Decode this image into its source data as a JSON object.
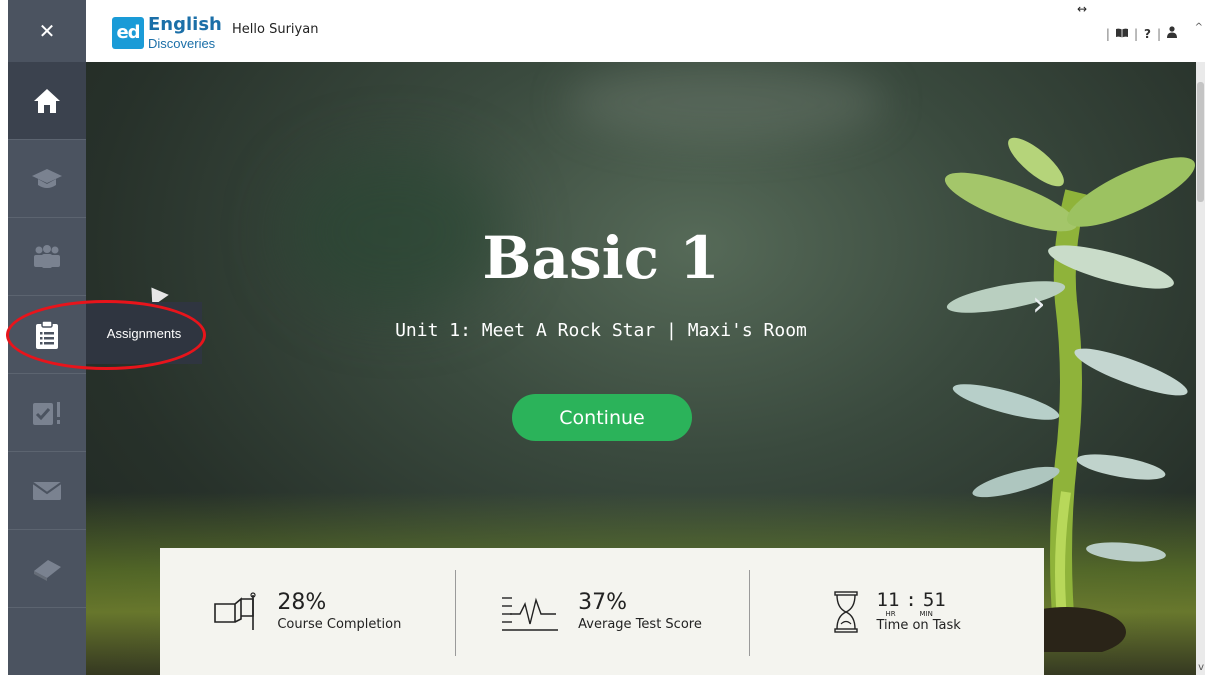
{
  "topbar": {
    "close_glyph": "✕",
    "logo_badge": "ed",
    "logo_word": "English",
    "logo_sub": "Discoveries",
    "greeting": "Hello Suriyan",
    "help_glyph": "?"
  },
  "sidebar": {
    "items": [
      {
        "id": "home",
        "icon": "home-icon"
      },
      {
        "id": "courses",
        "icon": "graduation-cap-icon"
      },
      {
        "id": "community",
        "icon": "users-icon"
      },
      {
        "id": "assignments",
        "icon": "clipboard-list-icon",
        "tooltip": "Assignments"
      },
      {
        "id": "tests",
        "icon": "checklist-alert-icon"
      },
      {
        "id": "messages",
        "icon": "envelope-icon"
      },
      {
        "id": "dictionary",
        "icon": "book-icon"
      }
    ]
  },
  "hero": {
    "title": "Basic 1",
    "subtitle": "Unit 1: Meet A Rock Star | Maxi's Room",
    "continue_label": "Continue",
    "next_glyph": "›"
  },
  "stats": {
    "completion": {
      "value": "28%",
      "label": "Course Completion",
      "icon": "flag-icon"
    },
    "test_score": {
      "value": "37%",
      "label": "Average Test Score",
      "icon": "pulse-chart-icon"
    },
    "time": {
      "hours": "11",
      "sep": ":",
      "minutes": "51",
      "hr_unit": "HR",
      "min_unit": "MIN",
      "label": "Time on Task",
      "icon": "hourglass-icon"
    }
  },
  "colors": {
    "sidebar": "#4b5360",
    "accent_green": "#2bb35a",
    "logo_blue": "#1a9bd7",
    "highlight_red": "#e8141b"
  }
}
